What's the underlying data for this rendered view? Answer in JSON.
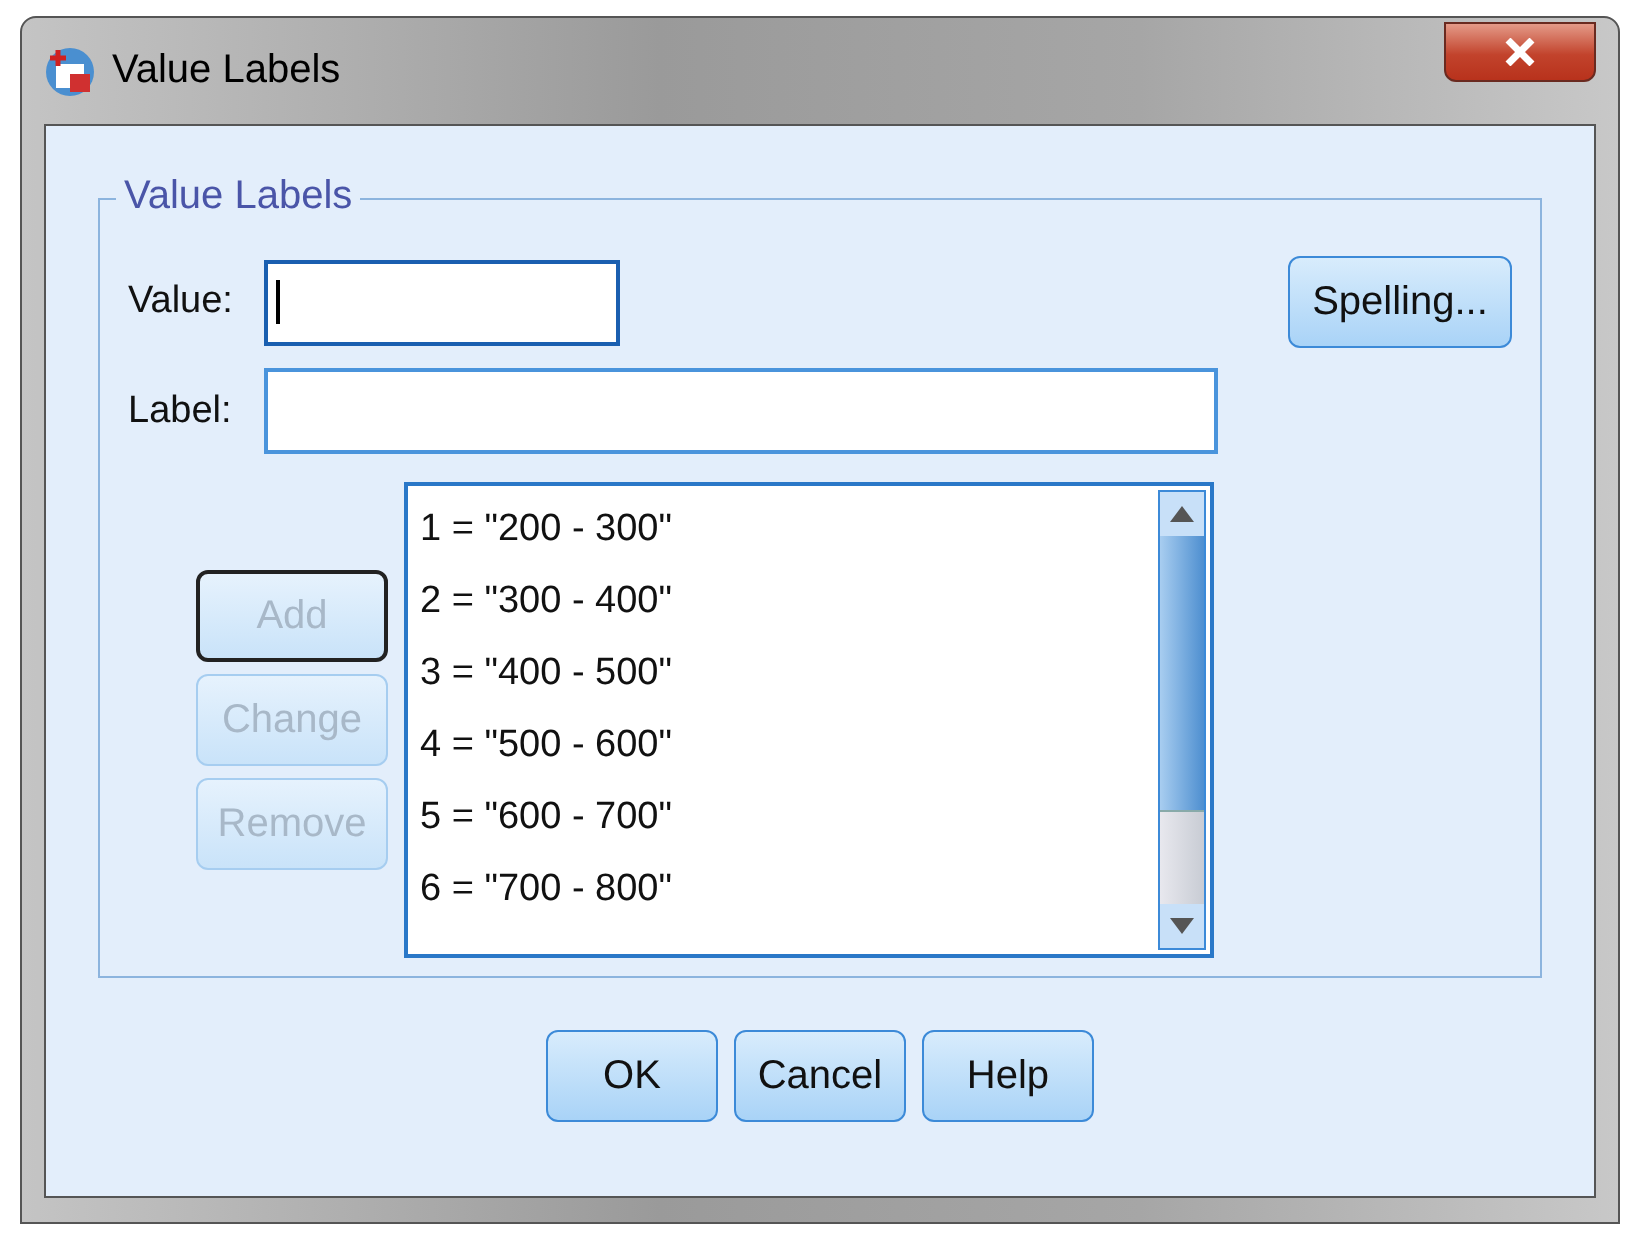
{
  "window": {
    "title": "Value Labels"
  },
  "group": {
    "title": "Value Labels"
  },
  "fields": [
    {
      "label": "Value:",
      "focused": true
    },
    {
      "label": "Label:",
      "focused": false
    }
  ],
  "spelling_button": {
    "label": "Spelling...",
    "disabled": false
  },
  "side_buttons": [
    {
      "label": "Add",
      "disabled": true,
      "default": true
    },
    {
      "label": "Change",
      "disabled": true,
      "default": false
    },
    {
      "label": "Remove",
      "disabled": true,
      "default": false
    }
  ],
  "list": {
    "items": [
      {
        "text": "1 = \"200 - 300\"",
        "selected": false
      },
      {
        "text": "2 = \"300 - 400\"",
        "selected": false
      },
      {
        "text": "3 = \"400 - 500\"",
        "selected": false
      },
      {
        "text": "4 = \"500 - 600\"",
        "selected": false
      },
      {
        "text": "5 = \"600 - 700\"",
        "selected": false
      },
      {
        "text": "6 = \"700 - 800\"",
        "selected": false
      }
    ]
  },
  "buttons": [
    {
      "label": "OK",
      "disabled": false
    },
    {
      "label": "Cancel",
      "disabled": false
    },
    {
      "label": "Help",
      "disabled": false
    }
  ]
}
